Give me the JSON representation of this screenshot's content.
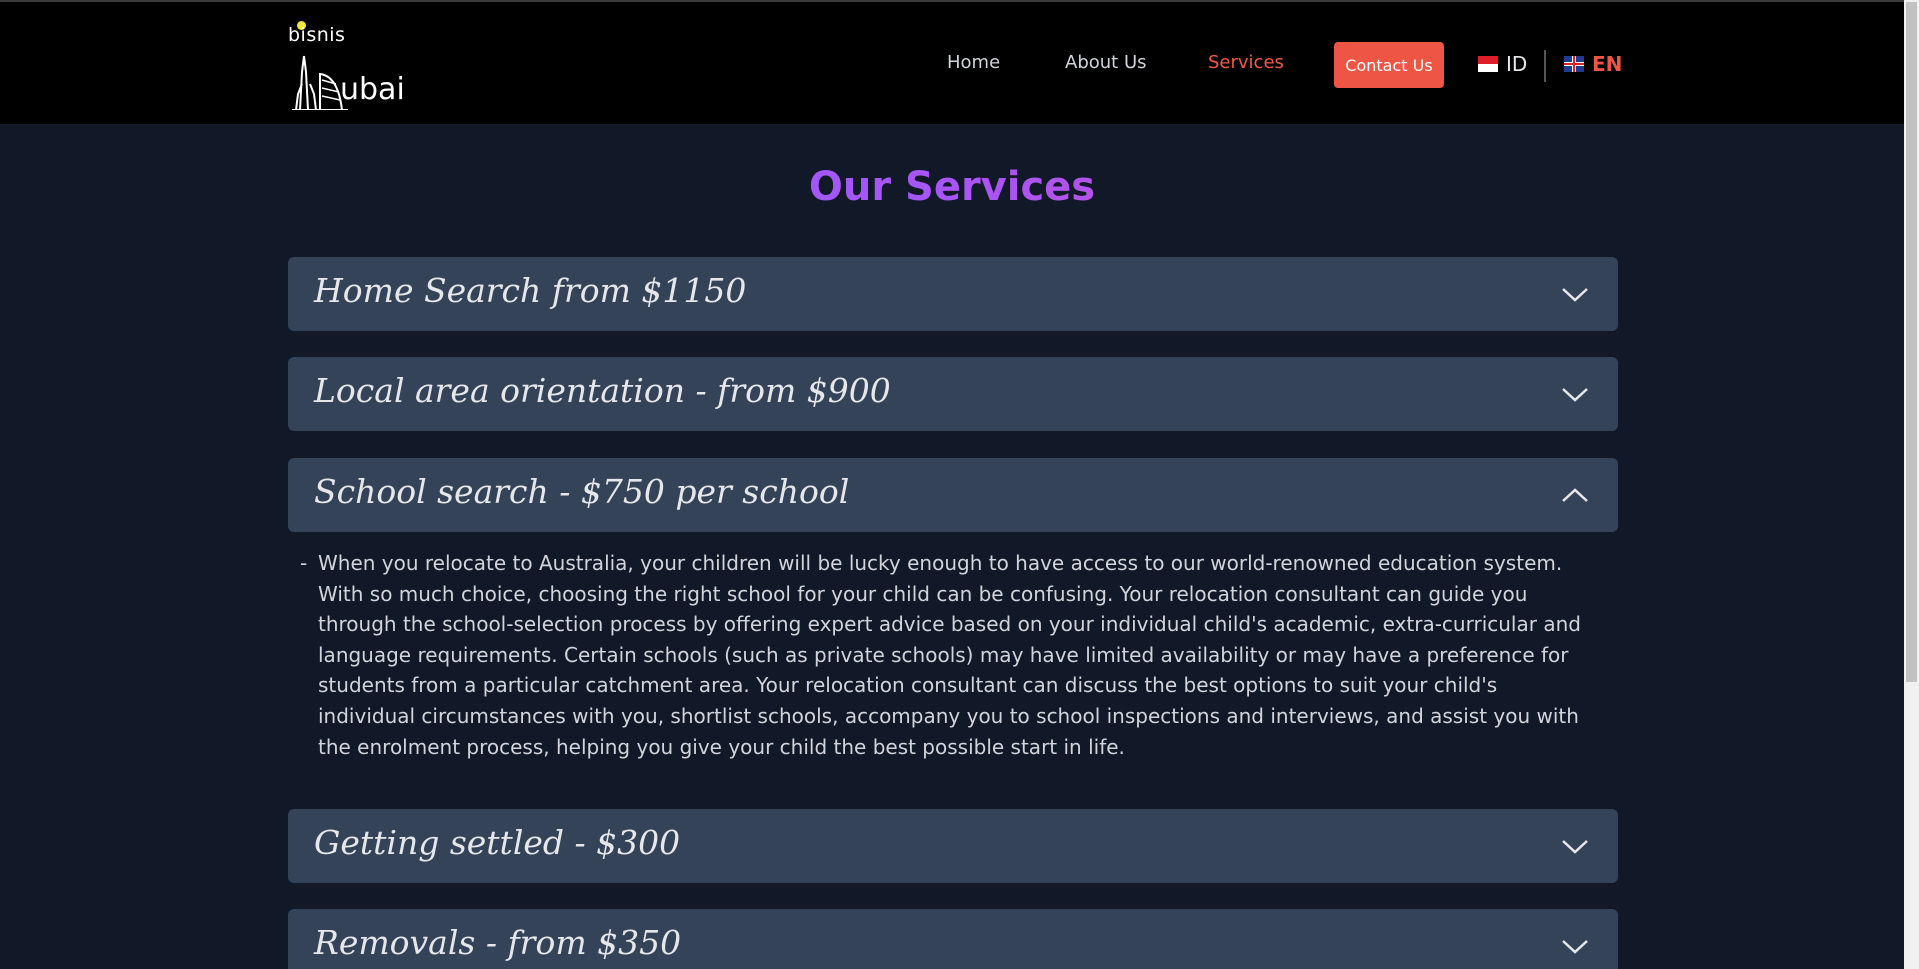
{
  "logo": {
    "top_text": "bisnis",
    "bottom_text": "ubai",
    "alt": "bisnis Dubai logo"
  },
  "nav": {
    "links": [
      {
        "label": "Home",
        "active": false
      },
      {
        "label": "About Us",
        "active": false
      },
      {
        "label": "Services",
        "active": true
      }
    ],
    "contact_label": "Contact Us",
    "languages": [
      {
        "code": "ID",
        "flag": "indonesia-flag-icon",
        "active": false
      },
      {
        "code": "EN",
        "flag": "uk-flag-icon",
        "active": true
      }
    ]
  },
  "colors": {
    "accent": "#ef5545",
    "panel": "#354359",
    "background": "#111827",
    "header": "#000000"
  },
  "page_title": "Our Services",
  "services": [
    {
      "title": "Home Search from $1150",
      "expanded": false
    },
    {
      "title": "Local area orientation - from $900",
      "expanded": false
    },
    {
      "title": "School search - $750 per school",
      "expanded": true,
      "body": "When you relocate to Australia, your children will be lucky enough to have access to our world-renowned education system. With so much choice, choosing the right school for your child can be confusing. Your relocation consultant can guide you through the school-selection process by offering expert advice based on your individual child's academic, extra-curricular and language requirements. Certain schools (such as private schools) may have limited availability or may have a preference for students from a particular catchment area. Your relocation consultant can discuss the best options to suit your child's individual circumstances with you, shortlist schools, accompany you to school inspections and interviews, and assist you with the enrolment process, helping you give your child the best possible start in life."
    },
    {
      "title": "Getting settled - $300",
      "expanded": false
    },
    {
      "title": "Removals - from $350",
      "expanded": false
    }
  ],
  "body_bullet": "-"
}
